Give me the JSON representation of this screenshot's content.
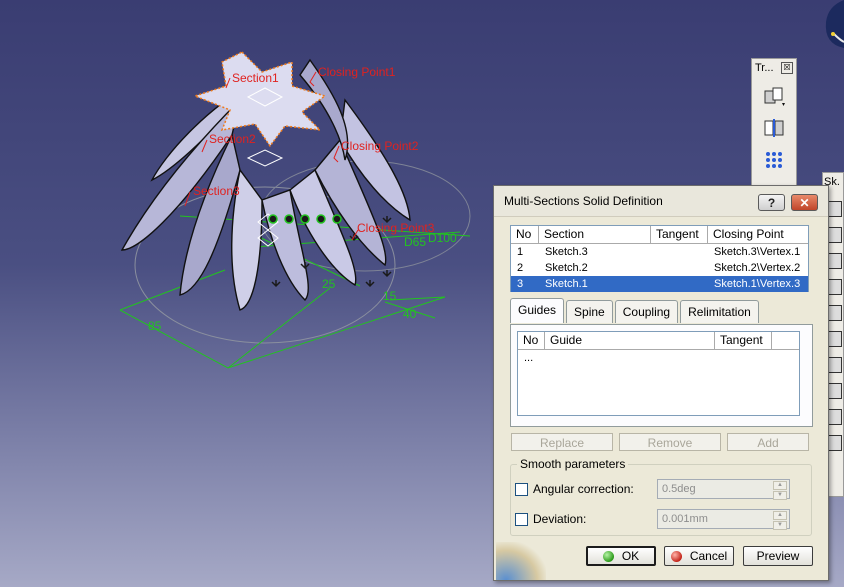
{
  "viewport": {
    "labels": {
      "section1": "Section1",
      "section2": "Section2",
      "section3": "Section3",
      "closing_point1": "Closing Point1",
      "closing_point2": "Closing Point2",
      "closing_point3": "Closing Point3"
    },
    "dimensions": {
      "d85": "85",
      "d40": "40",
      "d15": "15",
      "d100": "D100",
      "d65": "D65",
      "d25": "25"
    },
    "colors": {
      "solid": "#c9c9e6",
      "label": "#e0221f",
      "dimension": "#22c41f",
      "section_outline": "#f07a1a"
    }
  },
  "toolbar_tr": {
    "title": "Tr...",
    "close": "☒"
  },
  "toolbar_sk": {
    "title": "Sk."
  },
  "dialog": {
    "title": "Multi-Sections Solid Definition",
    "help_label": "?",
    "close_label": "✕",
    "sections_table": {
      "headers": [
        "No",
        "Section",
        "Tangent",
        "Closing Point"
      ],
      "rows": [
        {
          "no": "1",
          "section": "Sketch.3",
          "tangent": "",
          "closing_point": "Sketch.3\\Vertex.1"
        },
        {
          "no": "2",
          "section": "Sketch.2",
          "tangent": "",
          "closing_point": "Sketch.2\\Vertex.2"
        },
        {
          "no": "3",
          "section": "Sketch.1",
          "tangent": "",
          "closing_point": "Sketch.1\\Vertex.3"
        }
      ],
      "selected_row": 3
    },
    "tabs": [
      "Guides",
      "Spine",
      "Coupling",
      "Relimitation"
    ],
    "active_tab": "Guides",
    "guides_table": {
      "headers": [
        "No",
        "Guide",
        "Tangent"
      ],
      "rows": [
        {
          "no": "...",
          "guide": "",
          "tangent": ""
        }
      ]
    },
    "buttons": {
      "replace": "Replace",
      "remove": "Remove",
      "add": "Add"
    },
    "smooth": {
      "legend": "Smooth parameters",
      "angular_label": "Angular correction:",
      "angular_value": "0.5deg",
      "deviation_label": "Deviation:",
      "deviation_value": "0.001mm"
    },
    "footer": {
      "ok": "OK",
      "cancel": "Cancel",
      "preview": "Preview"
    }
  }
}
